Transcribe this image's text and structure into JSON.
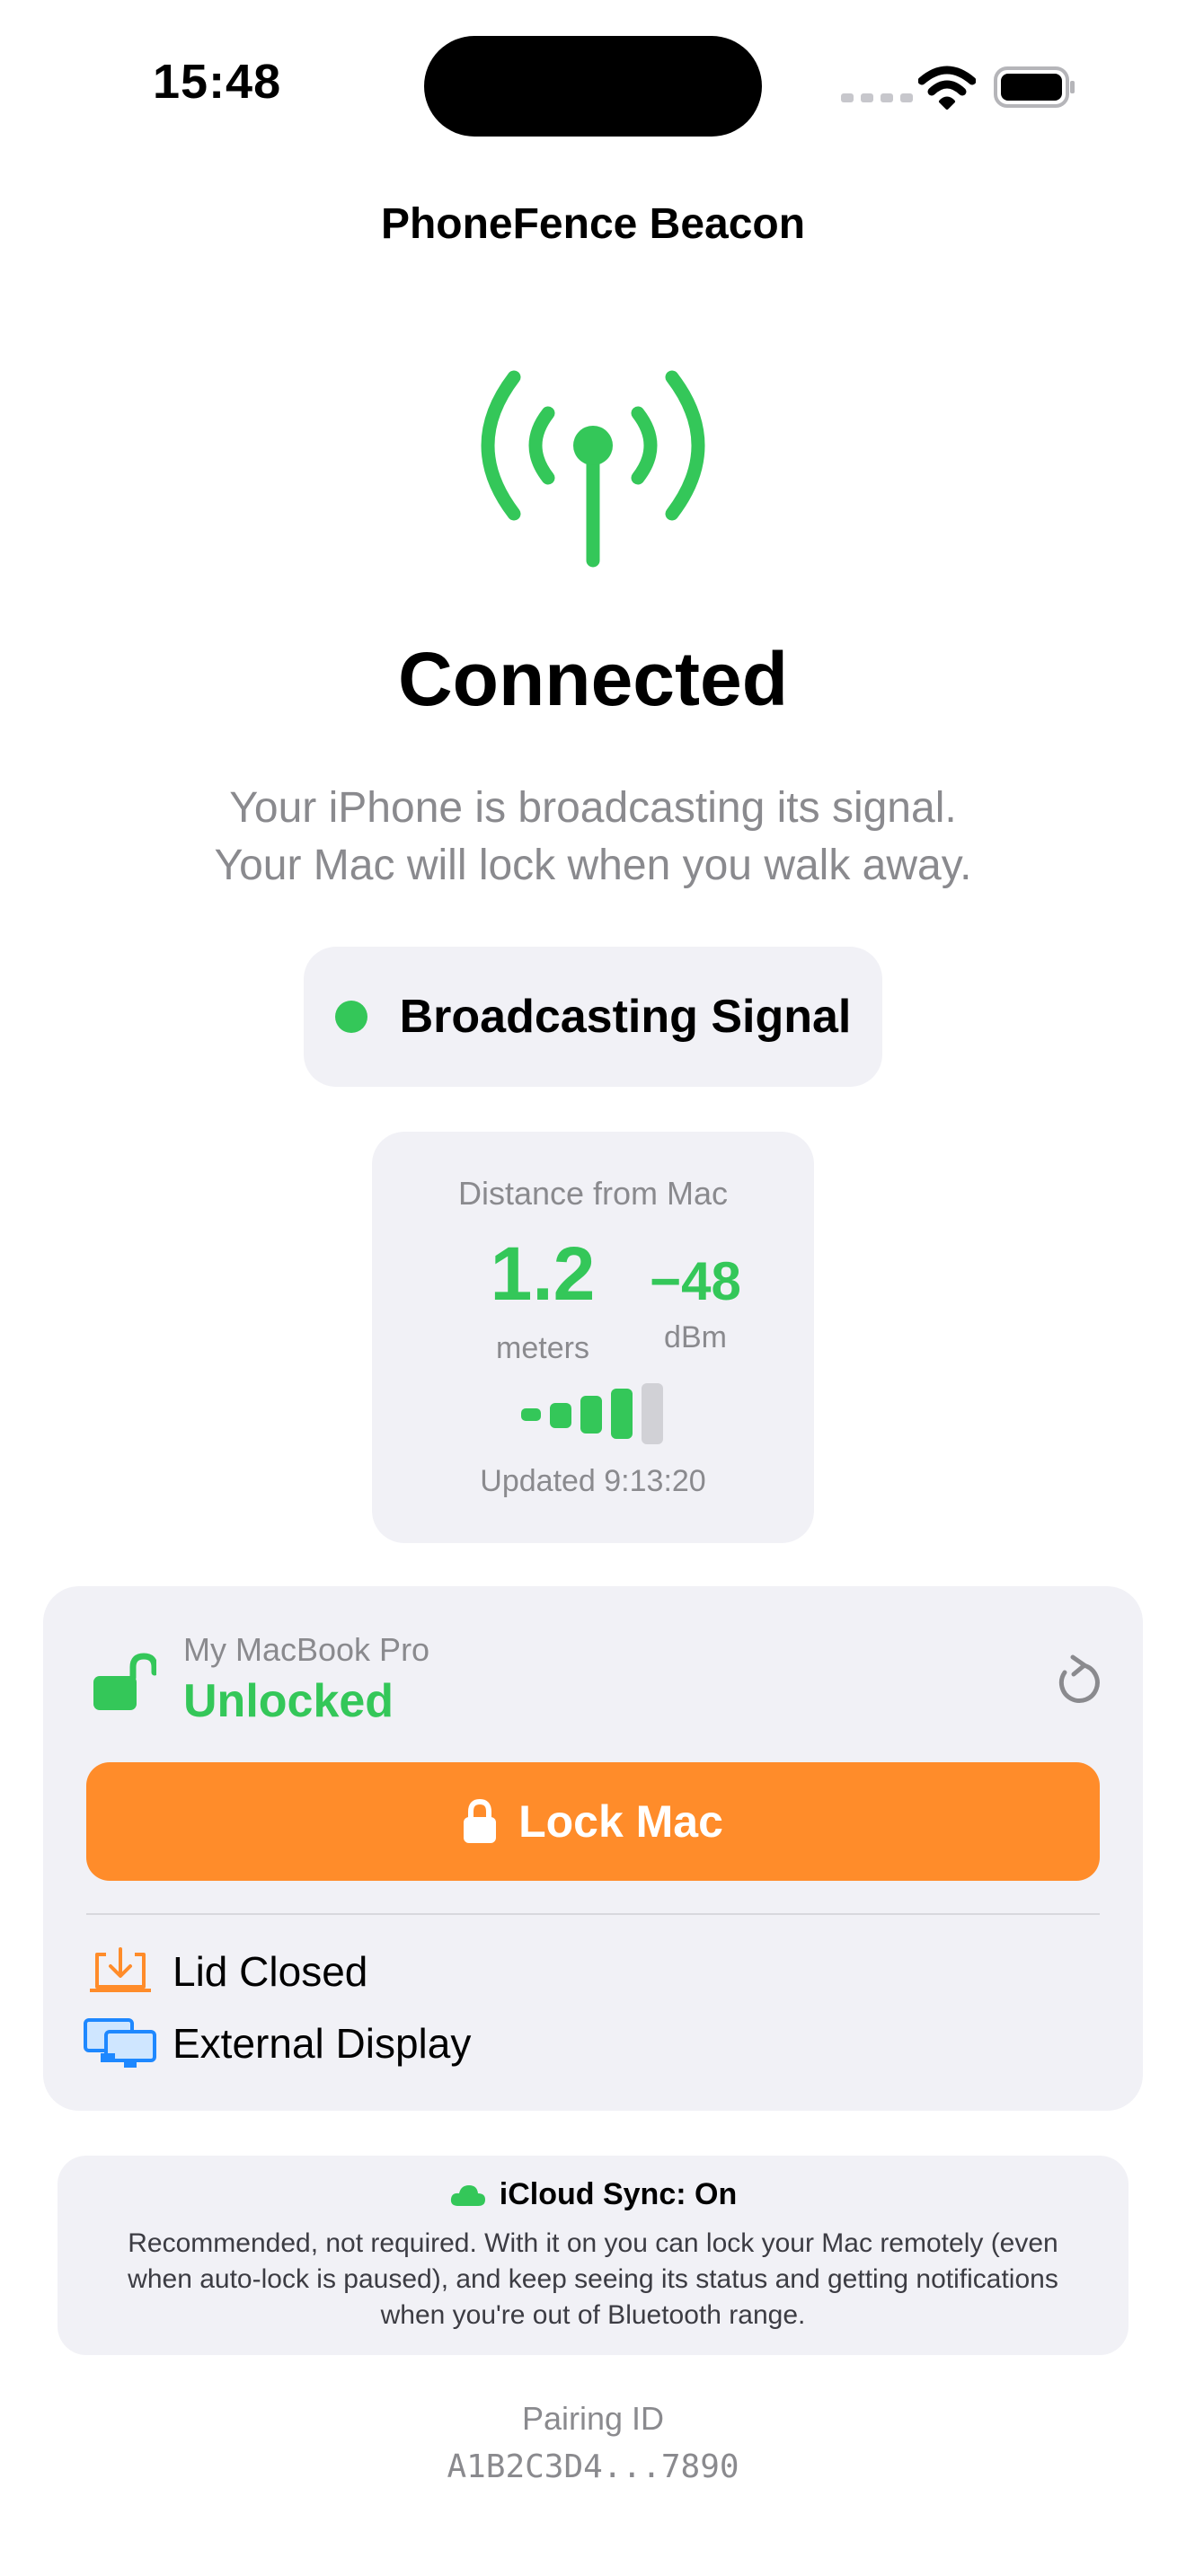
{
  "status_bar": {
    "time": "15:48",
    "icons": [
      "cellular-dots-icon",
      "wifi-icon",
      "battery-icon"
    ]
  },
  "nav": {
    "title": "PhoneFence Beacon"
  },
  "status": {
    "icon": "broadcast-antenna-icon",
    "heading": "Connected",
    "subtitle_line1": "Your iPhone is broadcasting its signal.",
    "subtitle_line2": "Your Mac will lock when you walk away.",
    "accent_color": "#34C759"
  },
  "broadcast": {
    "label": "Broadcasting Signal"
  },
  "distance": {
    "title": "Distance from Mac",
    "value": "1.2",
    "unit": "meters",
    "rssi": "−48",
    "rssi_unit": "dBm",
    "signal_bars_active": 4,
    "signal_bars_total": 5,
    "updated": "Updated 9:13:20"
  },
  "mac": {
    "name": "My MacBook Pro",
    "state": "Unlocked",
    "lock_button_label": "Lock Mac",
    "lock_button_color": "#FF8C2A",
    "info": [
      {
        "icon": "laptop-download-icon",
        "label": "Lid Closed"
      },
      {
        "icon": "displays-icon",
        "label": "External Display"
      }
    ]
  },
  "icloud": {
    "title": "iCloud Sync: On",
    "description": "Recommended, not required. With it on you can lock your Mac remotely (even when auto-lock is paused), and keep seeing its status and getting notifications when you're out of Bluetooth range."
  },
  "pairing": {
    "label": "Pairing ID",
    "id": "A1B2C3D4...7890"
  }
}
